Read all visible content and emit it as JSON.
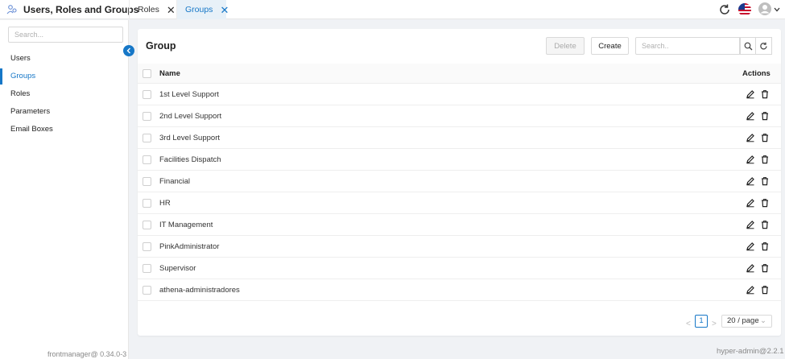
{
  "app": {
    "title": "Users, Roles and Groups",
    "logo_icon": "users-network-icon"
  },
  "tabs": [
    {
      "label": "Roles",
      "active": false
    },
    {
      "label": "Groups",
      "active": true
    }
  ],
  "header_icons": [
    "refresh-icon",
    "us-flag-icon",
    "user-avatar-icon",
    "chevron-down-icon"
  ],
  "sidebar": {
    "search_placeholder": "Search...",
    "items": [
      {
        "label": "Users",
        "active": false
      },
      {
        "label": "Groups",
        "active": true
      },
      {
        "label": "Roles",
        "active": false
      },
      {
        "label": "Parameters",
        "active": false
      },
      {
        "label": "Email Boxes",
        "active": false
      }
    ],
    "footer": "frontmanager@ 0.34.0-3"
  },
  "panel": {
    "title": "Group",
    "delete_label": "Delete",
    "create_label": "Create",
    "search_placeholder": "Search..",
    "columns": {
      "name": "Name",
      "actions": "Actions"
    },
    "rows": [
      "1st Level Support",
      "2nd Level Support",
      "3rd Level Support",
      "Facilities Dispatch",
      "Financial",
      "HR",
      "IT Management",
      "PinkAdministrator",
      "Supervisor",
      "athena-administradores"
    ],
    "pagination": {
      "prev": "<",
      "current_page": "1",
      "next": ">",
      "page_size": "20 / page"
    }
  },
  "footer_version": "hyper-admin@2.2.1",
  "colors": {
    "accent": "#1677c7",
    "tab_active_bg": "#e8f1f8",
    "background": "#f0f2f5"
  }
}
